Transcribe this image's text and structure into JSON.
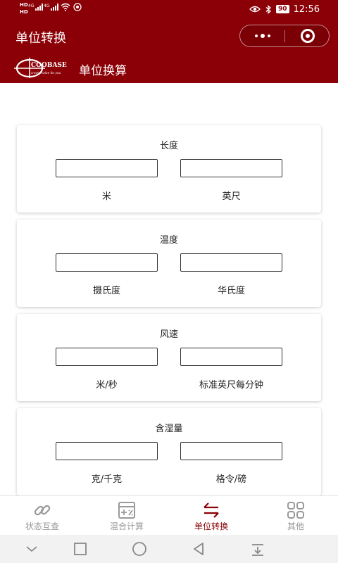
{
  "status_bar": {
    "hd1": "HD",
    "hd2": "HD",
    "net1": "4G",
    "net2": "4G",
    "battery": "90",
    "time": "12:56"
  },
  "title_bar": {
    "title": "单位转换"
  },
  "brand": {
    "logo_text": "COOBASE",
    "logo_slogan": "create value for you",
    "heading": "单位换算"
  },
  "cards": [
    {
      "title": "长度",
      "unit_a": "米",
      "unit_b": "英尺",
      "value_a": "",
      "value_b": ""
    },
    {
      "title": "温度",
      "unit_a": "摄氏度",
      "unit_b": "华氏度",
      "value_a": "",
      "value_b": ""
    },
    {
      "title": "风速",
      "unit_a": "米/秒",
      "unit_b": "标准英尺每分钟",
      "value_a": "",
      "value_b": ""
    },
    {
      "title": "含湿量",
      "unit_a": "克/千克",
      "unit_b": "格令/磅",
      "value_a": "",
      "value_b": ""
    }
  ],
  "tabs": [
    {
      "label": "状态互查",
      "icon": "link-icon",
      "active": false
    },
    {
      "label": "混合计算",
      "icon": "calculator-icon",
      "active": false
    },
    {
      "label": "单位转换",
      "icon": "swap-icon",
      "active": true
    },
    {
      "label": "其他",
      "icon": "grid-icon",
      "active": false
    }
  ],
  "colors": {
    "brand": "#8b0006",
    "tab_inactive": "#999999",
    "tab_active": "#8b0006"
  }
}
